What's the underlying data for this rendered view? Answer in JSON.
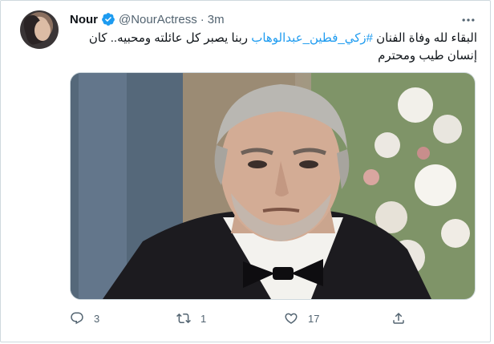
{
  "tweet": {
    "author_name": "Nour",
    "handle": "@NourActress",
    "separator": "·",
    "time": "3m",
    "text_before": "البقاء لله وفاة الفنان ",
    "hashtag": "#زكي_فطين_عبدالوهاب",
    "text_after": " ربنا يصبر كل عائلته ومحبيه.. كان إنسان طيب ومحترم",
    "media_description": "",
    "reply_count": "3",
    "retweet_count": "1",
    "like_count": "17"
  },
  "icons": {
    "verified": "verified-badge-icon",
    "more": "more-icon",
    "reply": "reply-icon",
    "retweet": "retweet-icon",
    "like": "heart-icon",
    "share": "share-icon"
  },
  "colors": {
    "link": "#1d9bf0",
    "secondary_text": "#536471",
    "border": "#cfd9de"
  }
}
